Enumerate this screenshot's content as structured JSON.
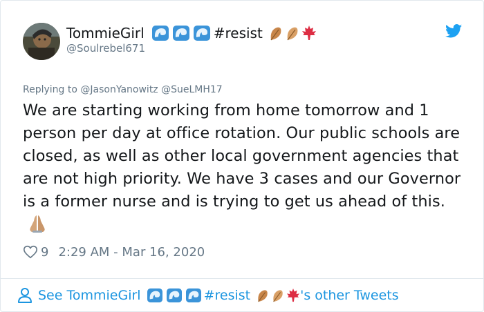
{
  "author": {
    "display_name": "TommieGirl",
    "hashtag": "#resist",
    "handle": "@Soulrebel671",
    "emoji_icons": [
      "water-wave-icon",
      "water-wave-icon",
      "water-wave-icon",
      "fallen-leaf-icon",
      "fallen-leaf-icon",
      "maple-leaf-icon"
    ]
  },
  "reply": {
    "prefix": "Replying to",
    "mentions": "@JasonYanowitz @SueLMH17"
  },
  "tweet": {
    "text": "We are starting working from home tomorrow and 1 person per day at office rotation. Our public schools are closed, as well as other local government agencies that are not high priority. We have 3 cases and our Governor is a former nurse and is trying to get us ahead of this.",
    "trailing_emoji": "folded-hands-icon"
  },
  "meta": {
    "like_count": "9",
    "timestamp": "2:29 AM - Mar 16, 2020"
  },
  "footer": {
    "prefix": "See TommieGirl",
    "hashtag": "#resist",
    "suffix": "'s other Tweets"
  },
  "colors": {
    "text": "#14171a",
    "muted": "#657786",
    "link": "#1b95e0",
    "twitter_blue": "#1da1f2",
    "border": "#e1e8ed"
  }
}
